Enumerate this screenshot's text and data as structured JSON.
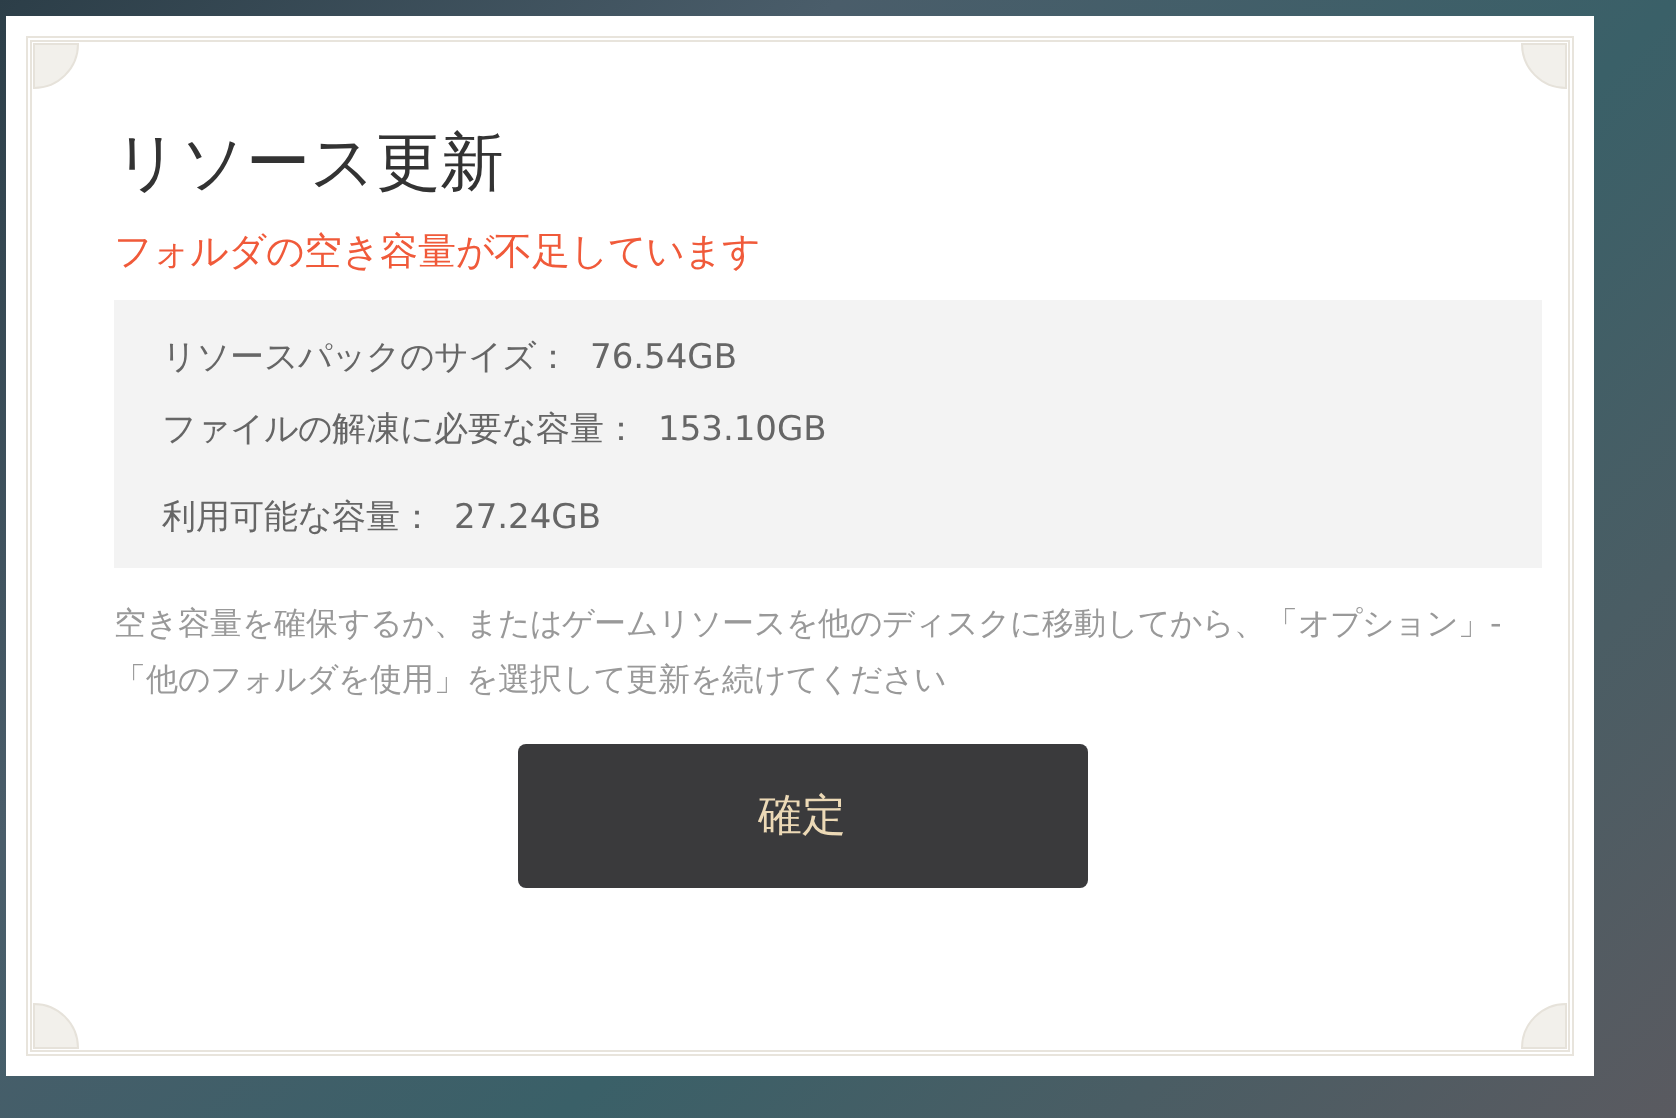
{
  "dialog": {
    "title": "リソース更新",
    "warning": "フォルダの空き容量が不足しています",
    "details": [
      {
        "label": "リソースパックのサイズ：",
        "value": "76.54GB"
      },
      {
        "label": "ファイルの解凍に必要な容量：",
        "value": "153.10GB"
      },
      {
        "label": "利用可能な容量：",
        "value": "27.24GB"
      }
    ],
    "message": "空き容量を確保するか、またはゲームリソースを他のディスクに移動してから、「オプション」-「他のフォルダを使用」を選択して更新を続けてください",
    "button": "確定"
  }
}
